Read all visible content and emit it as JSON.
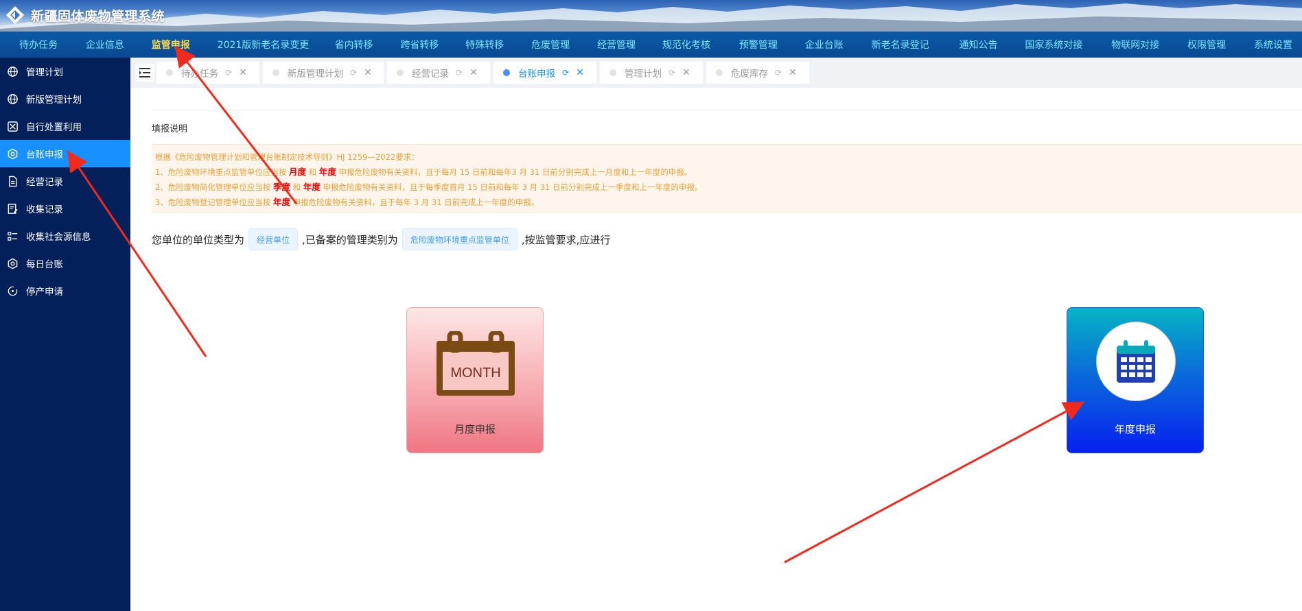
{
  "app": {
    "title": "新疆固体废物管理系统"
  },
  "topnav": {
    "items": [
      {
        "label": "待办任务"
      },
      {
        "label": "企业信息"
      },
      {
        "label": "监管申报"
      },
      {
        "label": "2021版新老名录变更"
      },
      {
        "label": "省内转移"
      },
      {
        "label": "跨省转移"
      },
      {
        "label": "特殊转移"
      },
      {
        "label": "危废管理"
      },
      {
        "label": "经营管理"
      },
      {
        "label": "规范化考核"
      },
      {
        "label": "预警管理"
      },
      {
        "label": "企业台账"
      },
      {
        "label": "新老名录登记"
      },
      {
        "label": "通知公告"
      },
      {
        "label": "国家系统对接"
      },
      {
        "label": "物联网对接"
      },
      {
        "label": "权限管理"
      },
      {
        "label": "系统设置"
      }
    ],
    "active_index": 2
  },
  "sidebar": {
    "items": [
      {
        "label": "管理计划",
        "icon": "globe-icon"
      },
      {
        "label": "新版管理计划",
        "icon": "globe-icon"
      },
      {
        "label": "自行处置利用",
        "icon": "recycle-icon"
      },
      {
        "label": "台账申报",
        "icon": "hexagon-icon"
      },
      {
        "label": "经营记录",
        "icon": "document-icon"
      },
      {
        "label": "收集记录",
        "icon": "edit-document-icon"
      },
      {
        "label": "收集社会源信息",
        "icon": "list-icon"
      },
      {
        "label": "每日台账",
        "icon": "hexagon-icon"
      },
      {
        "label": "停产申请",
        "icon": "power-icon"
      }
    ],
    "active_index": 3
  },
  "tabs": {
    "items": [
      {
        "label": "待办任务"
      },
      {
        "label": "新版管理计划"
      },
      {
        "label": "经营记录"
      },
      {
        "label": "台账申报"
      },
      {
        "label": "管理计划"
      },
      {
        "label": "危废库存"
      }
    ],
    "active_index": 3,
    "refresh_glyph": "⟳",
    "close_glyph": "✕"
  },
  "content": {
    "fill_title": "填报说明",
    "notice": {
      "line0": "根据《危险废物管理计划和管理台账制定技术导则》HJ 1259—2022要求：",
      "line1": {
        "pre": "1、危险废物环境重点监管单位应当按 ",
        "h1": "月度",
        "mid": " 和 ",
        "h2": "年度",
        "post": " 申报危险废物有关资料，且于每月 15 日前和每年3 月 31 日前分别完成上一月度和上一年度的申报。"
      },
      "line2": {
        "pre": "2、危险废物简化管理单位应当按 ",
        "h1": "季度",
        "mid": " 和 ",
        "h2": "年度",
        "post": " 申报危险废物有关资料，且于每季度首月 15 日前和每年 3 月 31 日前分别完成上一季度和上一年度的申报。"
      },
      "line3": {
        "pre": "3、危险废物登记管理单位应当按 ",
        "h1": "年度",
        "post": " 申报危险废物有关资料，且于每年 3 月 31 日前完成上一年度的申报。"
      }
    },
    "unit_line": {
      "prefix": "您单位的单位类型为",
      "unit_type": "经营单位",
      "middle": ",已备案的管理类别为",
      "category": "危险废物环境重点监管单位",
      "suffix": ",按监管要求,应进行"
    },
    "cards": {
      "month": {
        "label": "月度申报",
        "icon_text": "MONTH"
      },
      "year": {
        "label": "年度申报"
      }
    }
  },
  "colors": {
    "nav_bg": "#0a4a93",
    "nav_text": "#7fe6ff",
    "nav_active": "#ffd84a",
    "sidebar_bg": "#03205b",
    "sidebar_active": "#1890ff",
    "arrow": "#f02a1c",
    "highlight_red": "#ff0000",
    "notice_text": "#e6a23c"
  }
}
